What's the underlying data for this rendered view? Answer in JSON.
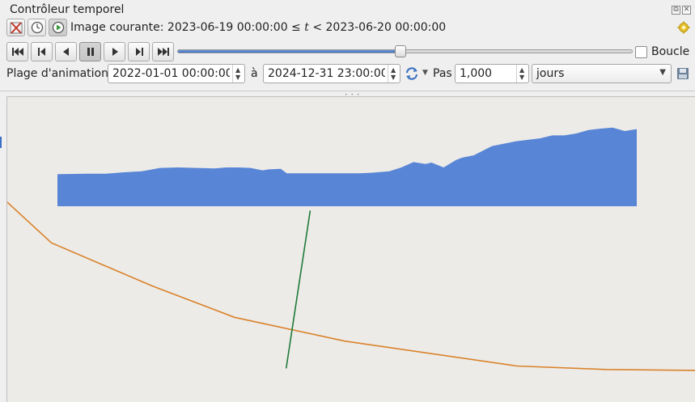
{
  "window": {
    "title": "Contrôleur temporel"
  },
  "toolbar": {
    "current_frame_prefix": "Image courante: 2023-06-19 00:00:00 ≤ ",
    "current_frame_var": "t",
    "current_frame_suffix": " < 2023-06-20 00:00:00",
    "icons": [
      "disable-temporal-icon",
      "fixed-range-icon",
      "animated-icon",
      "settings-gear-icon"
    ]
  },
  "playback": {
    "buttons": [
      "skip-to-start",
      "step-back",
      "play-backward",
      "pause",
      "play",
      "step-forward",
      "skip-to-end"
    ],
    "paused": true,
    "slider_position": 0.49,
    "loop_label": "Boucle",
    "loop_checked": false
  },
  "range": {
    "label": "Plage d'animation",
    "start": "2022-01-01 00:00:00",
    "to_label": "à",
    "end": "2024-12-31 23:00:00",
    "step_label": "Pas",
    "step_value": "1,000",
    "unit": "jours"
  },
  "colors": {
    "accent": "#3f72c2",
    "area_fill": "#5885d6",
    "line_orange": "#d9822b",
    "line_green": "#1f7a3a",
    "map_background": "#edebe7"
  },
  "map": {
    "area_profile": [
      0,
      0.66,
      0.05,
      0.67,
      0.08,
      0.67,
      0.11,
      0.7,
      0.14,
      0.72,
      0.17,
      0.79,
      0.2,
      0.8,
      0.23,
      0.79,
      0.26,
      0.78,
      0.28,
      0.8,
      0.3,
      0.8,
      0.32,
      0.79,
      0.34,
      0.74,
      0.35,
      0.76,
      0.37,
      0.77,
      0.38,
      0.68,
      0.42,
      0.68,
      0.46,
      0.68,
      0.5,
      0.68,
      0.52,
      0.69,
      0.55,
      0.72,
      0.57,
      0.8,
      0.59,
      0.91,
      0.61,
      0.87,
      0.62,
      0.9,
      0.64,
      0.8,
      0.66,
      0.95,
      0.67,
      1.0,
      0.69,
      1.05,
      0.72,
      1.24,
      0.76,
      1.34,
      0.8,
      1.4,
      0.82,
      1.46,
      0.84,
      1.46,
      0.86,
      1.5,
      0.88,
      1.57,
      0.9,
      1.6,
      0.92,
      1.62,
      0.94,
      1.55,
      0.96,
      1.59
    ],
    "orange_line": [
      [
        0,
        0
      ],
      [
        0.064,
        0.186
      ],
      [
        0.21,
        0.383
      ],
      [
        0.33,
        0.527
      ],
      [
        0.49,
        0.636
      ],
      [
        0.74,
        0.75
      ],
      [
        0.87,
        0.766
      ],
      [
        1.0,
        0.77
      ]
    ],
    "green_line": [
      [
        0.44,
        0.36
      ],
      [
        0.405,
        0.86
      ]
    ]
  }
}
